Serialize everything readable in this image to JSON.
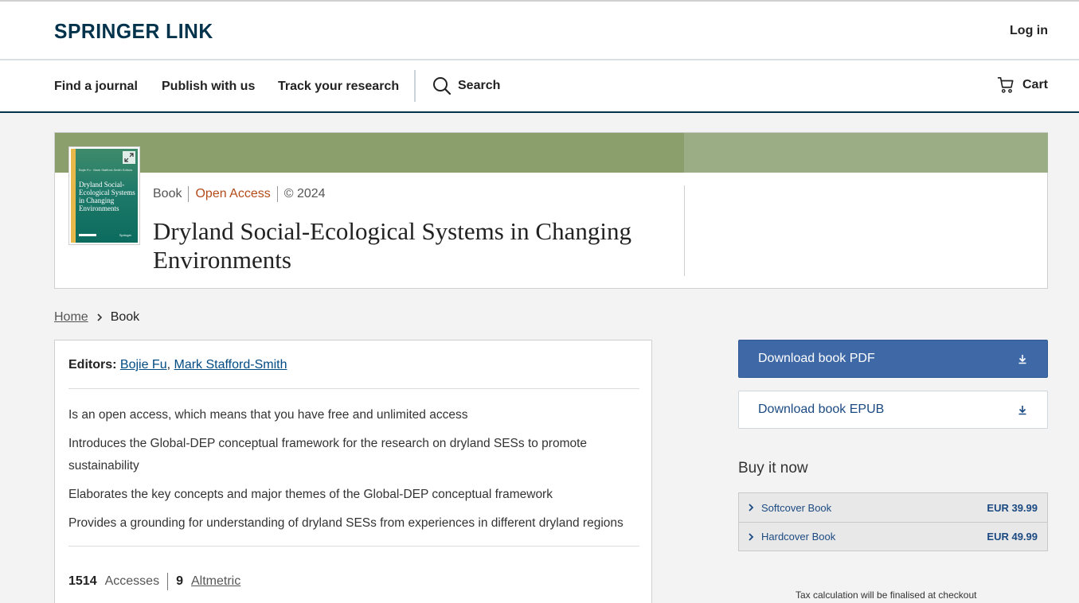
{
  "header": {
    "logo": "SPRINGER LINK",
    "login": "Log in"
  },
  "nav": {
    "items": [
      "Find a journal",
      "Publish with us",
      "Track your research"
    ],
    "search": "Search",
    "cart": "Cart"
  },
  "book": {
    "type": "Book",
    "access": "Open Access",
    "year": "© 2024",
    "title": "Dryland Social-Ecological Systems in Changing Environments",
    "cover_title": "Dryland Social-Ecological Systems in Changing Environments",
    "cover_authors": "Bojie Fu · Mark Stafford-Smith Editors",
    "cover_publisher": "Springer"
  },
  "breadcrumb": {
    "home": "Home",
    "current": "Book"
  },
  "details": {
    "editors_label": "Editors:",
    "editors": [
      "Bojie Fu",
      "Mark Stafford-Smith"
    ],
    "bullets": [
      "Is an open access, which means that you have free and unlimited access",
      "Introduces the Global-DEP conceptual framework for the research on dryland SESs to promote sustainability",
      "Elaborates the key concepts and major themes of the Global-DEP conceptual framework",
      "Provides a grounding for understanding of dryland SESs from experiences in different dryland regions"
    ],
    "accesses_count": "1514",
    "accesses_label": "Accesses",
    "altmetric_count": "9",
    "altmetric_label": "Altmetric"
  },
  "sidebar": {
    "download_pdf": "Download book PDF",
    "download_epub": "Download book EPUB",
    "buy_title": "Buy it now",
    "options": [
      {
        "label": "Softcover Book",
        "price": "EUR 39.99"
      },
      {
        "label": "Hardcover Book",
        "price": "EUR 49.99"
      }
    ],
    "tax_note": "Tax calculation will be finalised at checkout"
  },
  "colors": {
    "brand": "#01324b",
    "primary_button": "#3e68a6",
    "open_access": "#b34b19",
    "hero_band": "#8a9f6b"
  }
}
